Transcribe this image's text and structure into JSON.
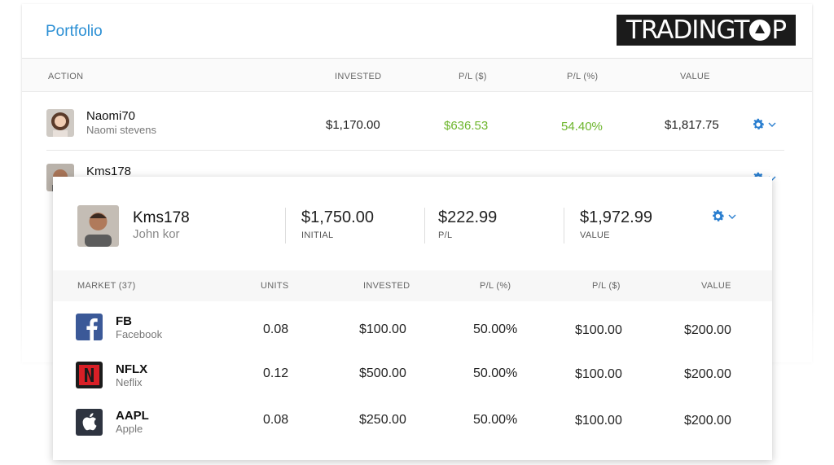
{
  "header": {
    "title": "Portfolio",
    "logo_text_left": "TRADINGT",
    "logo_text_right": "P"
  },
  "columns": {
    "action": "ACTION",
    "invested": "INVESTED",
    "pl_usd": "P/L ($)",
    "pl_pct": "P/L (%)",
    "value": "VALUE"
  },
  "rows": [
    {
      "username": "Naomi70",
      "fullname": "Naomi stevens",
      "invested": "$1,170.00",
      "pl_usd": "$636.53",
      "pl_pct": "54.40%",
      "value": "$1,817.75"
    },
    {
      "username": "Kms178"
    }
  ],
  "detail": {
    "username": "Kms178",
    "fullname": "John kor",
    "initial_value": "$1,750.00",
    "initial_label": "INITIAL",
    "pl_value": "$222.99",
    "pl_label": "P/L",
    "value_value": "$1,972.99",
    "value_label": "VALUE",
    "columns": {
      "market": "MARKET (37)",
      "units": "UNITS",
      "invested": "INVESTED",
      "pl_pct": "P/L (%)",
      "pl_usd": "P/L ($)",
      "value": "VALUE"
    },
    "markets": [
      {
        "ticker": "FB",
        "name": "Facebook",
        "icon": "facebook-icon",
        "units": "0.08",
        "invested": "$100.00",
        "pl_pct": "50.00%",
        "pl_usd": "$100.00",
        "value": "$200.00"
      },
      {
        "ticker": "NFLX",
        "name": "Neflix",
        "icon": "netflix-icon",
        "units": "0.12",
        "invested": "$500.00",
        "pl_pct": "50.00%",
        "pl_usd": "$100.00",
        "value": "$200.00"
      },
      {
        "ticker": "AAPL",
        "name": "Apple",
        "icon": "apple-icon",
        "units": "0.08",
        "invested": "$250.00",
        "pl_pct": "50.00%",
        "pl_usd": "$100.00",
        "value": "$200.00"
      }
    ]
  },
  "colors": {
    "accent": "#2b8fd4",
    "positive": "#6cb52b",
    "gear": "#2b7fd0"
  }
}
